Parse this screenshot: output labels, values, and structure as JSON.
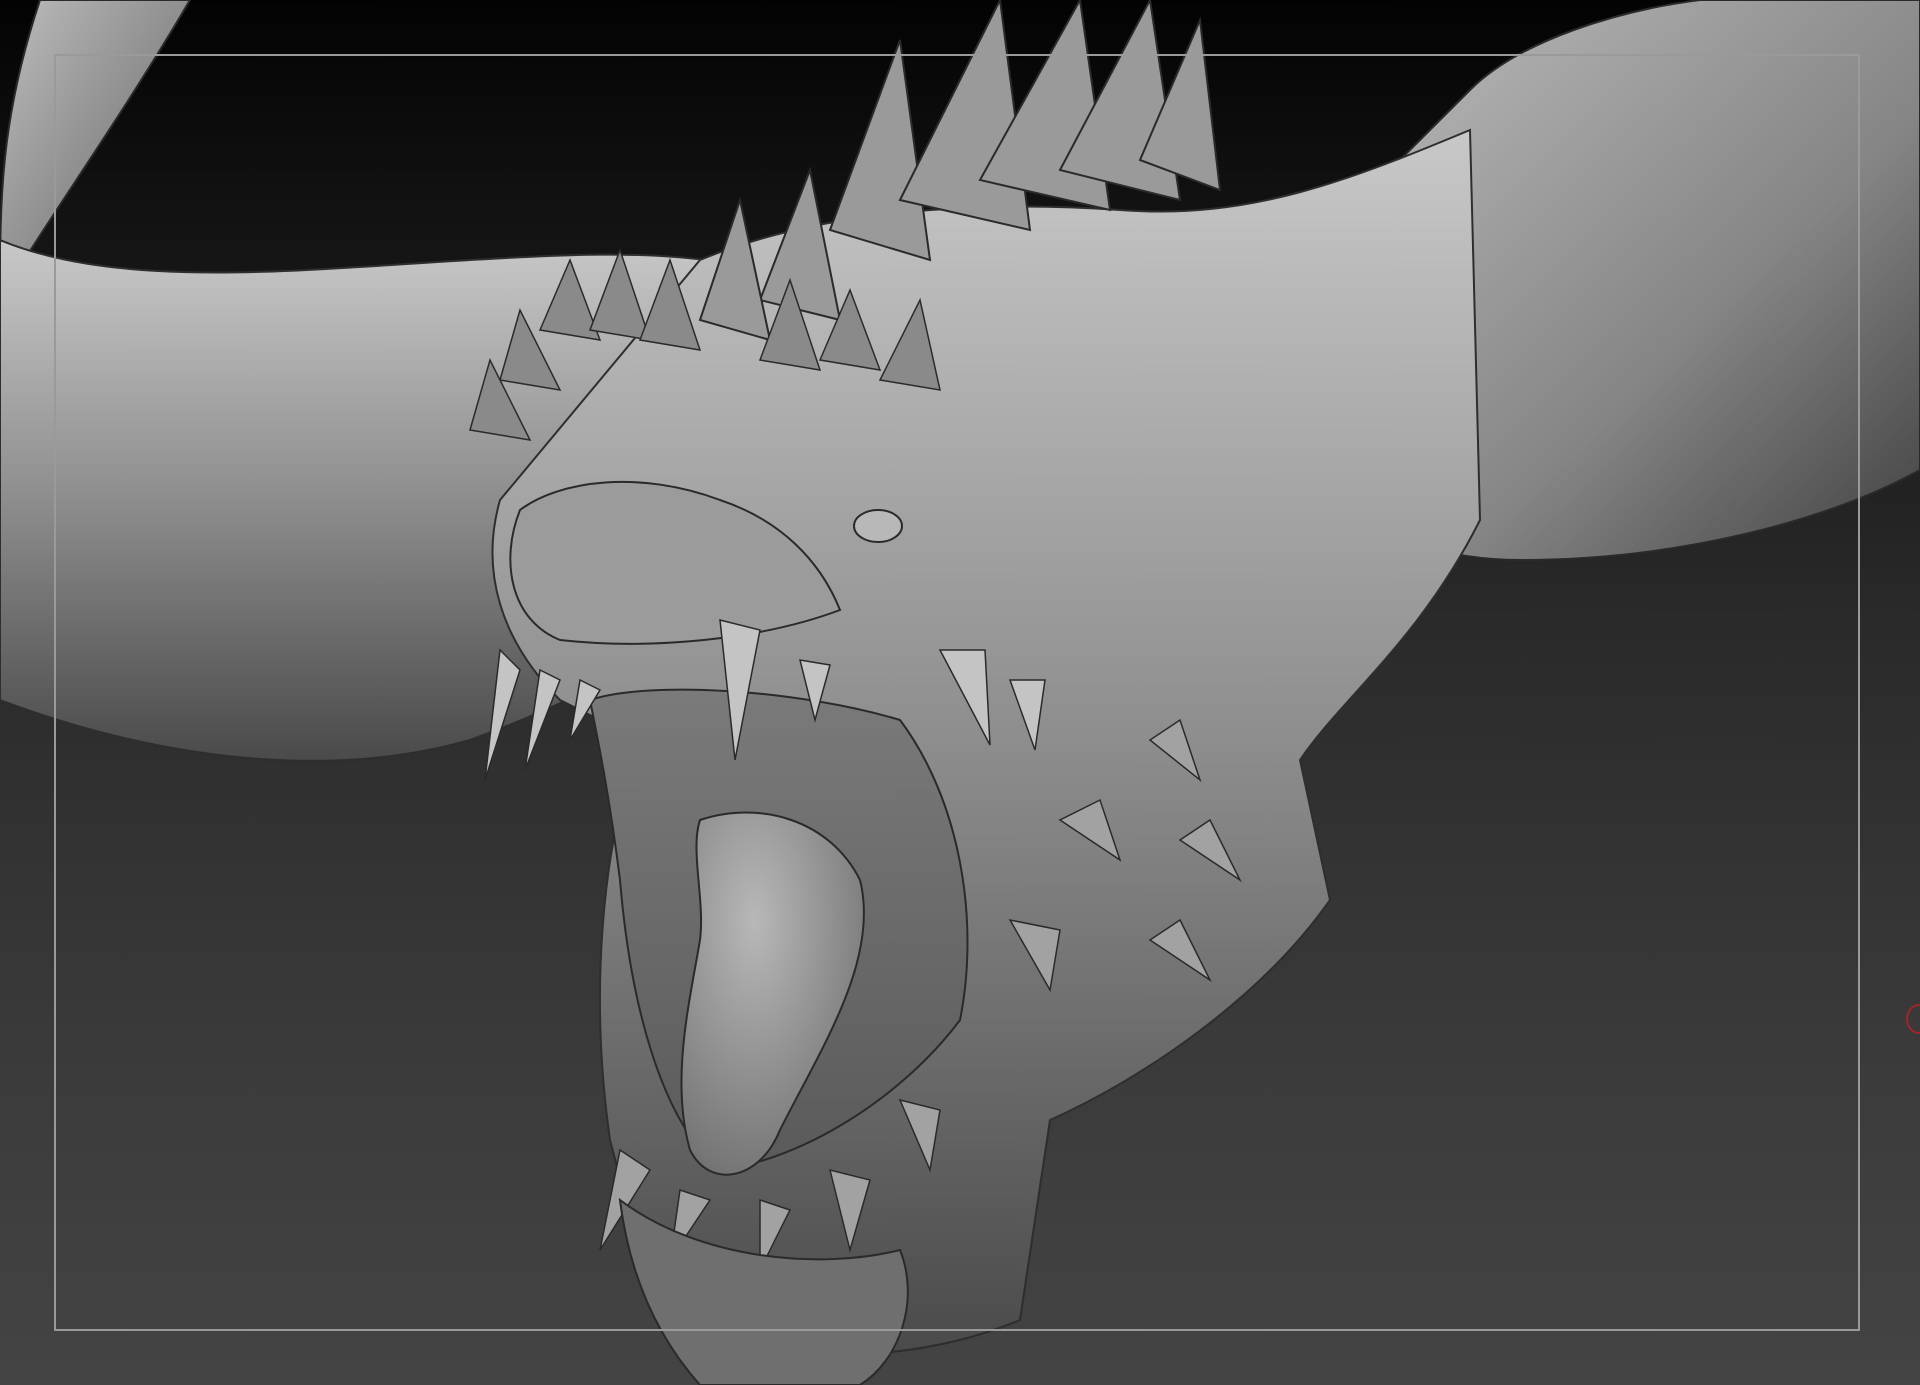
{
  "viewport": {
    "mode": "3d-sculpt-preview",
    "model": "dragon-head-bust",
    "background_gradient": [
      "#030303",
      "#444444"
    ],
    "material_color": "#8f8f8f",
    "frame_color": "#9a9a9a",
    "gizmo_color": "#a2232a"
  }
}
